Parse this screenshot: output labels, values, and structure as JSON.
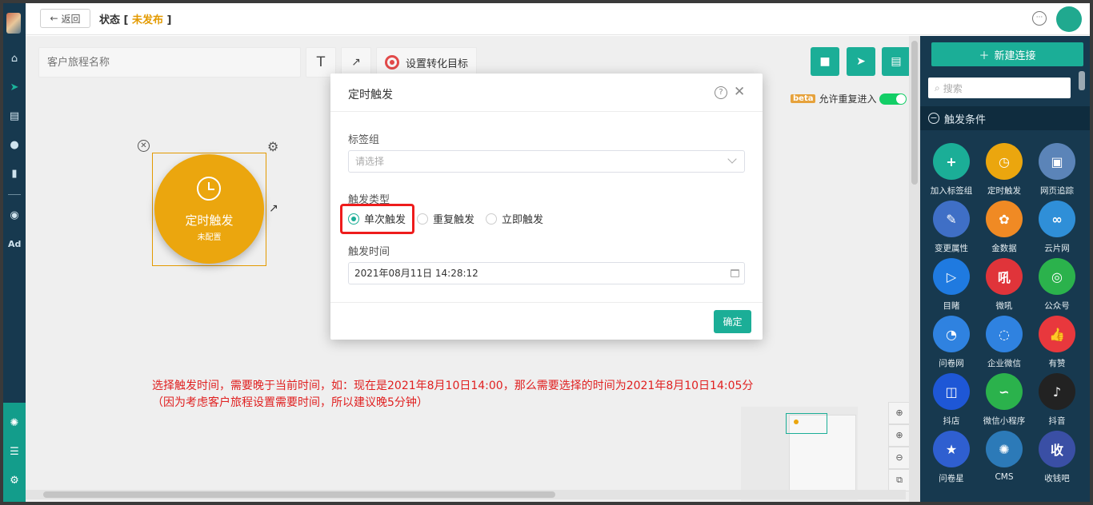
{
  "header": {
    "back_label": "返回",
    "status_label": "状态 [ ",
    "status_value": "未发布",
    "status_suffix": " ]"
  },
  "toolbar": {
    "name_placeholder": "客户旅程名称",
    "text_tool": "T",
    "arrow_tool": "↗",
    "goal_label": "设置转化目标"
  },
  "canvas": {
    "beta_badge": "beta",
    "allow_reentry_label": "允许重复进入",
    "node": {
      "title": "定时触发",
      "subtitle": "未配置"
    },
    "note_line1": "选择触发时间，需要晚于当前时间，如：现在是2021年8月10日14:00，那么需要选择的时间为2021年8月10日14:05分",
    "note_line2": "（因为考虑客户旅程设置需要时间，所以建议晚5分钟）"
  },
  "modal": {
    "title": "定时触发",
    "tag_group_label": "标签组",
    "tag_group_placeholder": "请选择",
    "trigger_type_label": "触发类型",
    "options": [
      "单次触发",
      "重复触发",
      "立即触发"
    ],
    "selected_option": "单次触发",
    "trigger_time_label": "触发时间",
    "trigger_time_value": "2021年08月11日 14:28:12",
    "confirm_label": "确定"
  },
  "rpanel": {
    "new_connection_label": "新建连接",
    "search_placeholder": "搜索",
    "section_title": "触发条件",
    "items": [
      {
        "label": "加入标签组",
        "color": "#1bae97",
        "glyph": "+"
      },
      {
        "label": "定时触发",
        "color": "#eba60e",
        "glyph": "◷"
      },
      {
        "label": "网页追踪",
        "color": "#5b84b8",
        "glyph": "▣"
      },
      {
        "label": "变更属性",
        "color": "#3f6fc6",
        "glyph": "✎"
      },
      {
        "label": "金数据",
        "color": "#f08a24",
        "glyph": "✿"
      },
      {
        "label": "云片网",
        "color": "#2f8fd8",
        "glyph": "∞"
      },
      {
        "label": "目睹",
        "color": "#1f7ae0",
        "glyph": "▷"
      },
      {
        "label": "微吼",
        "color": "#e0343a",
        "glyph": "吼"
      },
      {
        "label": "公众号",
        "color": "#2bb24c",
        "glyph": "◎"
      },
      {
        "label": "问卷网",
        "color": "#2f82e0",
        "glyph": "◔"
      },
      {
        "label": "企业微信",
        "color": "#2f82e0",
        "glyph": "◌"
      },
      {
        "label": "有赞",
        "color": "#e8383d",
        "glyph": "👍"
      },
      {
        "label": "抖店",
        "color": "#1e57d6",
        "glyph": "◫"
      },
      {
        "label": "微信小程序",
        "color": "#2bb24c",
        "glyph": "∽"
      },
      {
        "label": "抖音",
        "color": "#222222",
        "glyph": "♪"
      },
      {
        "label": "问卷星",
        "color": "#2f5fd0",
        "glyph": "★"
      },
      {
        "label": "CMS",
        "color": "#2c7ab8",
        "glyph": "✺"
      },
      {
        "label": "收钱吧",
        "color": "#3a4fa5",
        "glyph": "收"
      }
    ]
  }
}
